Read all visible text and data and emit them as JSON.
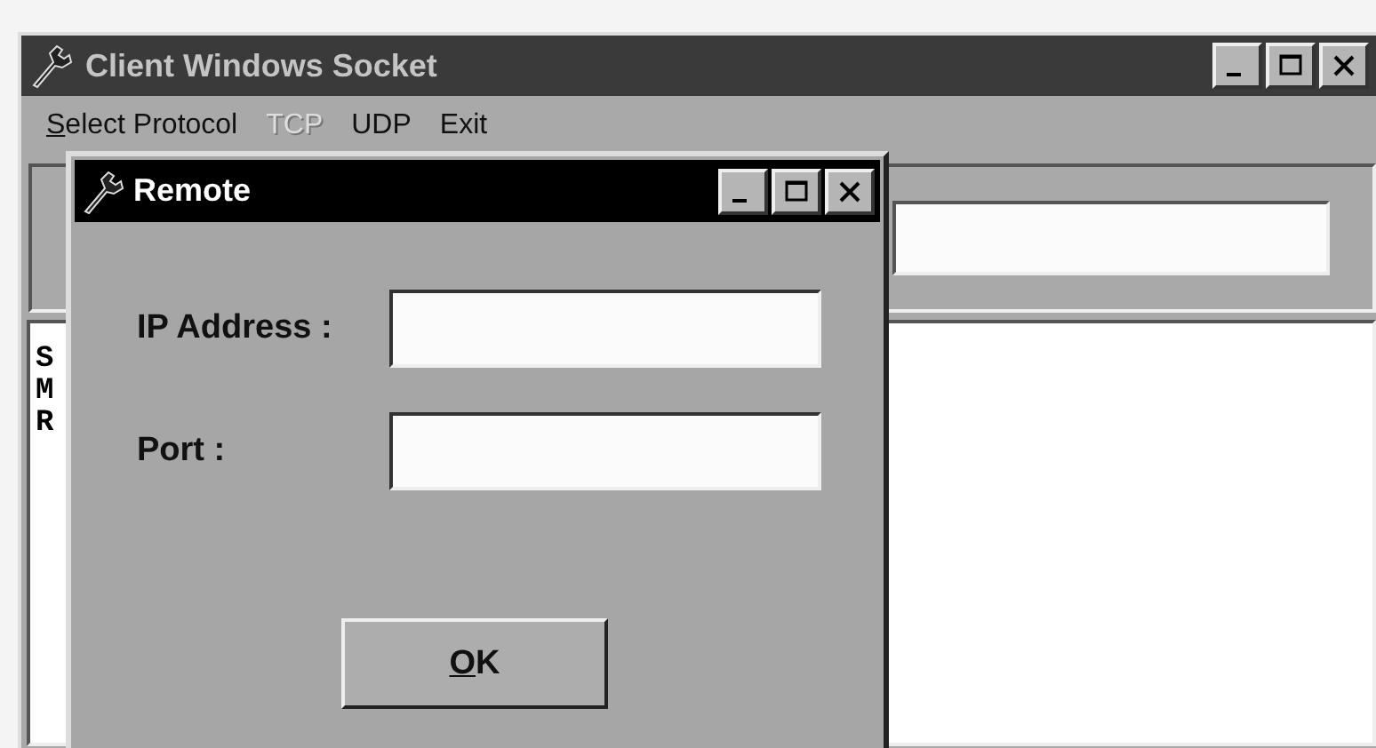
{
  "window": {
    "title": "Client Windows Socket",
    "active": false
  },
  "menu": [
    {
      "label": "Select Protocol",
      "mnemonic": true,
      "disabled": false
    },
    {
      "label": "TCP",
      "mnemonic": false,
      "disabled": true
    },
    {
      "label": "UDP",
      "mnemonic": false,
      "disabled": false
    },
    {
      "label": "Exit",
      "mnemonic": false,
      "disabled": false
    }
  ],
  "log_lines": [
    "S",
    "M",
    "R"
  ],
  "dialog": {
    "title": "Remote",
    "active": true,
    "fields": [
      {
        "label": "IP Address :"
      },
      {
        "label": "Port :"
      }
    ],
    "button": {
      "label": "OK",
      "mnemonic": true
    }
  }
}
